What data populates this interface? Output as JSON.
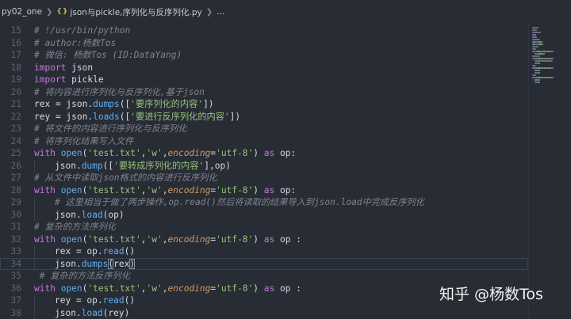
{
  "breadcrumb": {
    "folder": "py02_one",
    "file_icon": "{ }",
    "file": "json与pickle,序列化与反序列化.py",
    "symbol": "..."
  },
  "editor": {
    "current_line": 34,
    "lines": [
      {
        "n": 15,
        "indent": 0,
        "tokens": [
          [
            "cmt",
            "# !/usr/bin/python"
          ]
        ]
      },
      {
        "n": 16,
        "indent": 0,
        "tokens": [
          [
            "cmt",
            "# author:杨数Tos"
          ]
        ]
      },
      {
        "n": 17,
        "indent": 0,
        "tokens": [
          [
            "cmt",
            "# 微信: 杨数Tos (ID:DataYang)"
          ]
        ]
      },
      {
        "n": 18,
        "indent": 0,
        "tokens": [
          [
            "kw",
            "import"
          ],
          [
            "id",
            " json"
          ]
        ]
      },
      {
        "n": 19,
        "indent": 0,
        "tokens": [
          [
            "kw",
            "import"
          ],
          [
            "id",
            " pickle"
          ]
        ]
      },
      {
        "n": 20,
        "indent": 0,
        "tokens": [
          [
            "cmt",
            "# 将内容进行序列化与反序列化,基于json"
          ]
        ]
      },
      {
        "n": 21,
        "indent": 0,
        "tokens": [
          [
            "id",
            "rex = json."
          ],
          [
            "fn",
            "dumps"
          ],
          [
            "brk",
            "(["
          ],
          [
            "str",
            "'要序列化的内容'"
          ],
          [
            "brk",
            "])"
          ]
        ]
      },
      {
        "n": 22,
        "indent": 0,
        "tokens": [
          [
            "id",
            "rey = json."
          ],
          [
            "fn",
            "loads"
          ],
          [
            "brk",
            "(["
          ],
          [
            "str",
            "'要进行反序列化的内容'"
          ],
          [
            "brk",
            "])"
          ]
        ]
      },
      {
        "n": 23,
        "indent": 0,
        "tokens": [
          [
            "cmt",
            "# 将文件的内容进行序列化与反序列化"
          ]
        ]
      },
      {
        "n": 24,
        "indent": 0,
        "tokens": [
          [
            "cmt",
            "# 将序列化结果写入文件"
          ]
        ]
      },
      {
        "n": 25,
        "indent": 0,
        "tokens": [
          [
            "kw",
            "with"
          ],
          [
            "id",
            " "
          ],
          [
            "fn",
            "open"
          ],
          [
            "brk",
            "("
          ],
          [
            "str",
            "'test.txt'"
          ],
          [
            "id",
            ","
          ],
          [
            "str",
            "'w'"
          ],
          [
            "id",
            ","
          ],
          [
            "param",
            "encoding"
          ],
          [
            "id",
            "="
          ],
          [
            "str",
            "'utf-8'"
          ],
          [
            "brk",
            ")"
          ],
          [
            "id",
            " "
          ],
          [
            "kw",
            "as"
          ],
          [
            "id",
            " op:"
          ]
        ]
      },
      {
        "n": 26,
        "indent": 1,
        "tokens": [
          [
            "id",
            "json."
          ],
          [
            "fn",
            "dump"
          ],
          [
            "brk",
            "(["
          ],
          [
            "str",
            "'要转成序列化的内容'"
          ],
          [
            "brk",
            "]"
          ],
          [
            "id",
            ",op"
          ],
          [
            "brk",
            ")"
          ]
        ]
      },
      {
        "n": 27,
        "indent": 0,
        "tokens": [
          [
            "cmt",
            "# 从文件中读取json格式的内容进行反序列化"
          ]
        ]
      },
      {
        "n": 28,
        "indent": 0,
        "tokens": [
          [
            "kw",
            "with"
          ],
          [
            "id",
            " "
          ],
          [
            "fn",
            "open"
          ],
          [
            "brk",
            "("
          ],
          [
            "str",
            "'test.txt'"
          ],
          [
            "id",
            ","
          ],
          [
            "str",
            "'w'"
          ],
          [
            "id",
            ","
          ],
          [
            "param",
            "encoding"
          ],
          [
            "id",
            "="
          ],
          [
            "str",
            "'utf-8'"
          ],
          [
            "brk",
            ")"
          ],
          [
            "id",
            " "
          ],
          [
            "kw",
            "as"
          ],
          [
            "id",
            " op:"
          ]
        ]
      },
      {
        "n": 29,
        "indent": 1,
        "tokens": [
          [
            "cmt",
            "# 这里相当于做了两步操作,op.read()然后将读取的结果导入到json.load中完成反序列化"
          ]
        ]
      },
      {
        "n": 30,
        "indent": 1,
        "tokens": [
          [
            "id",
            "json."
          ],
          [
            "fn",
            "load"
          ],
          [
            "brk",
            "("
          ],
          [
            "id",
            "op"
          ],
          [
            "brk",
            ")"
          ]
        ]
      },
      {
        "n": 31,
        "indent": 0,
        "tokens": [
          [
            "cmt",
            "# 复杂的方法序列化"
          ]
        ]
      },
      {
        "n": 32,
        "indent": 0,
        "tokens": [
          [
            "kw",
            "with"
          ],
          [
            "id",
            " "
          ],
          [
            "fn",
            "open"
          ],
          [
            "brk",
            "("
          ],
          [
            "str",
            "'test.txt'"
          ],
          [
            "id",
            ","
          ],
          [
            "str",
            "'w'"
          ],
          [
            "id",
            ","
          ],
          [
            "param",
            "encoding"
          ],
          [
            "id",
            "="
          ],
          [
            "str",
            "'utf-8'"
          ],
          [
            "brk",
            ")"
          ],
          [
            "id",
            " "
          ],
          [
            "kw",
            "as"
          ],
          [
            "id",
            " op :"
          ]
        ]
      },
      {
        "n": 33,
        "indent": 1,
        "tokens": [
          [
            "id",
            "rex = op."
          ],
          [
            "fn",
            "read"
          ],
          [
            "brk",
            "()"
          ]
        ]
      },
      {
        "n": 34,
        "indent": 1,
        "tokens": [
          [
            "id",
            "json."
          ],
          [
            "fn",
            "dumps"
          ],
          [
            "brkm",
            "("
          ],
          [
            "id",
            "rex"
          ],
          [
            "brkm",
            ")"
          ]
        ]
      },
      {
        "n": 35,
        "indent": 0,
        "tokens": [
          [
            "cmt",
            " # 复杂的方法反序列化"
          ]
        ]
      },
      {
        "n": 36,
        "indent": 0,
        "tokens": [
          [
            "kw",
            "with"
          ],
          [
            "id",
            " "
          ],
          [
            "fn",
            "open"
          ],
          [
            "brk",
            "("
          ],
          [
            "str",
            "'test.txt'"
          ],
          [
            "id",
            ","
          ],
          [
            "str",
            "'w'"
          ],
          [
            "id",
            ","
          ],
          [
            "param",
            "encoding"
          ],
          [
            "id",
            "="
          ],
          [
            "str",
            "'utf-8'"
          ],
          [
            "brk",
            ")"
          ],
          [
            "id",
            " "
          ],
          [
            "kw",
            "as"
          ],
          [
            "id",
            " op :"
          ]
        ]
      },
      {
        "n": 37,
        "indent": 1,
        "tokens": [
          [
            "id",
            "rey = op."
          ],
          [
            "fn",
            "read"
          ],
          [
            "brk",
            "()"
          ]
        ]
      },
      {
        "n": 38,
        "indent": 1,
        "tokens": [
          [
            "id",
            "json."
          ],
          [
            "fn",
            "load"
          ],
          [
            "brk",
            "("
          ],
          [
            "id",
            "rey"
          ],
          [
            "brk",
            ")"
          ]
        ]
      }
    ]
  },
  "watermark": "知乎 @杨数Tos",
  "colors": {
    "background": "#272c35",
    "keyword": "#c678dd",
    "function": "#61afef",
    "string": "#98c379",
    "comment": "#7f848e",
    "parameter": "#d19a66"
  }
}
